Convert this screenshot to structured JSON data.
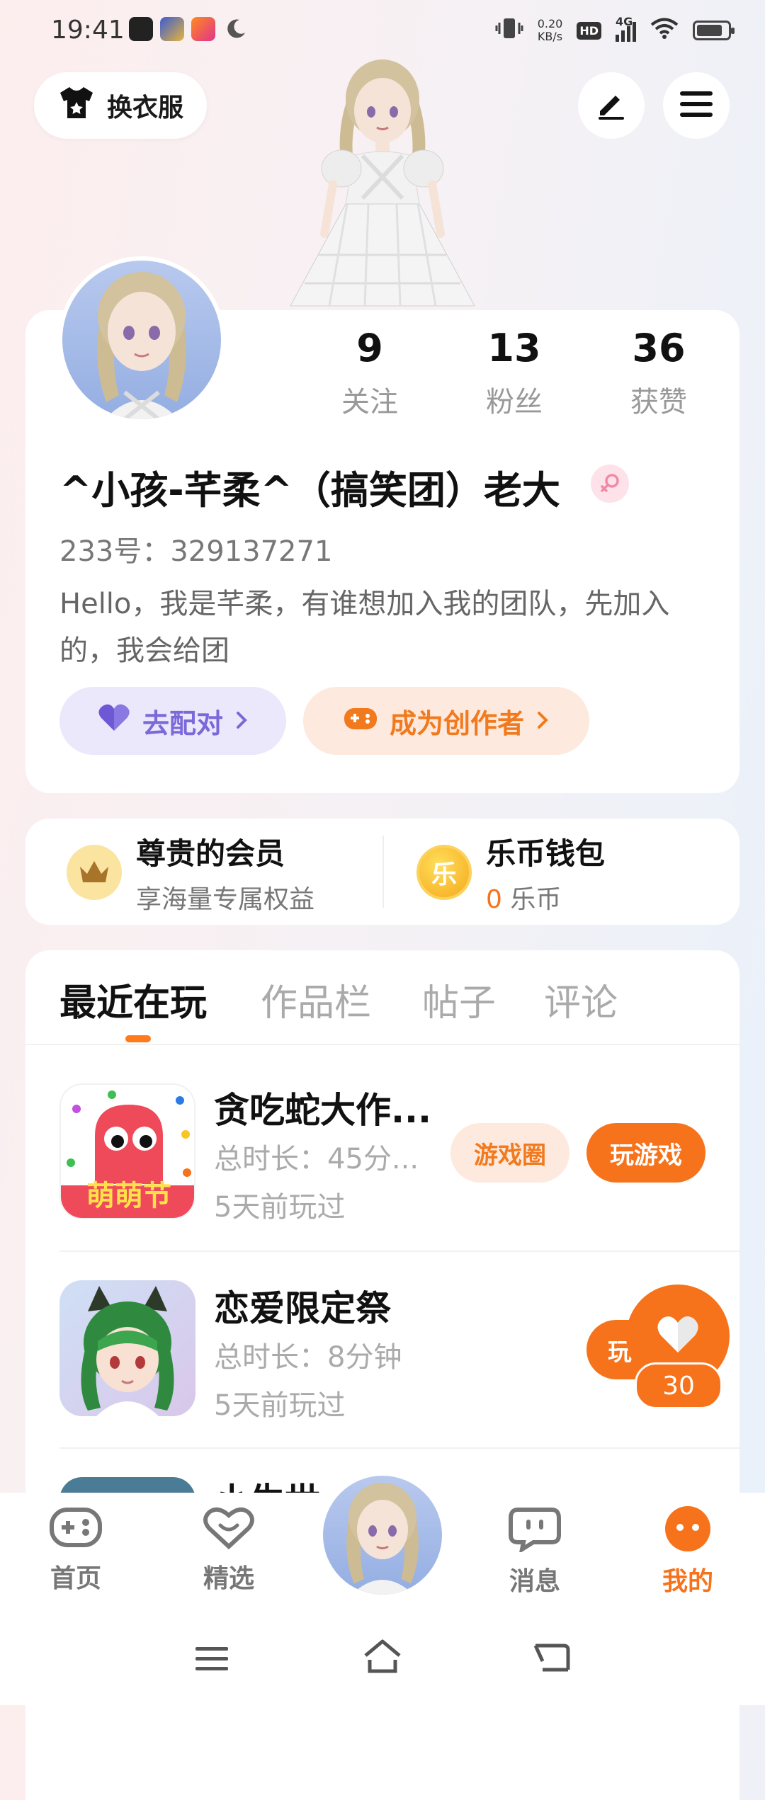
{
  "status_bar": {
    "time": "19:41",
    "net_speed_top": "0.20",
    "net_speed_unit": "KB/s",
    "hd": "HD",
    "network": "4G"
  },
  "top_bar": {
    "outfit_label": "换衣服"
  },
  "profile": {
    "stats": [
      {
        "num": "9",
        "label": "关注"
      },
      {
        "num": "13",
        "label": "粉丝"
      },
      {
        "num": "36",
        "label": "获赞"
      }
    ],
    "nickname": "^小孩-芊柔^（搞笑团）老大",
    "uid": "233号：329137271",
    "bio": "Hello，我是芊柔，有谁想加入我的团队，先加入的，我会给团",
    "match_label": "去配对",
    "creator_label": "成为创作者"
  },
  "vip": {
    "title": "尊贵的会员",
    "subtitle": "享海量专属权益",
    "wallet_title": "乐币钱包",
    "wallet_amount": "0",
    "wallet_unit": "乐币",
    "wallet_coin_char": "乐"
  },
  "tabs": [
    "最近在玩",
    "作品栏",
    "帖子",
    "评论"
  ],
  "games": [
    {
      "name": "贪吃蛇大作...",
      "duration": "总时长：45分...",
      "last_played": "5天前玩过",
      "circle_label": "游戏圈",
      "play_label": "玩游戏",
      "icon_text": "萌萌节"
    },
    {
      "name": "恋爱限定祭",
      "duration": "总时长：8分钟",
      "last_played": "5天前玩过",
      "play_label": "玩"
    }
  ],
  "third_game_partial": "小生世",
  "float_like": {
    "count": "30"
  },
  "bottom_nav": [
    {
      "label": "首页"
    },
    {
      "label": "精选"
    },
    {
      "label": "消息"
    },
    {
      "label": "我的"
    }
  ],
  "colors": {
    "accent": "#f6731c",
    "purple": "#7b68d9"
  }
}
